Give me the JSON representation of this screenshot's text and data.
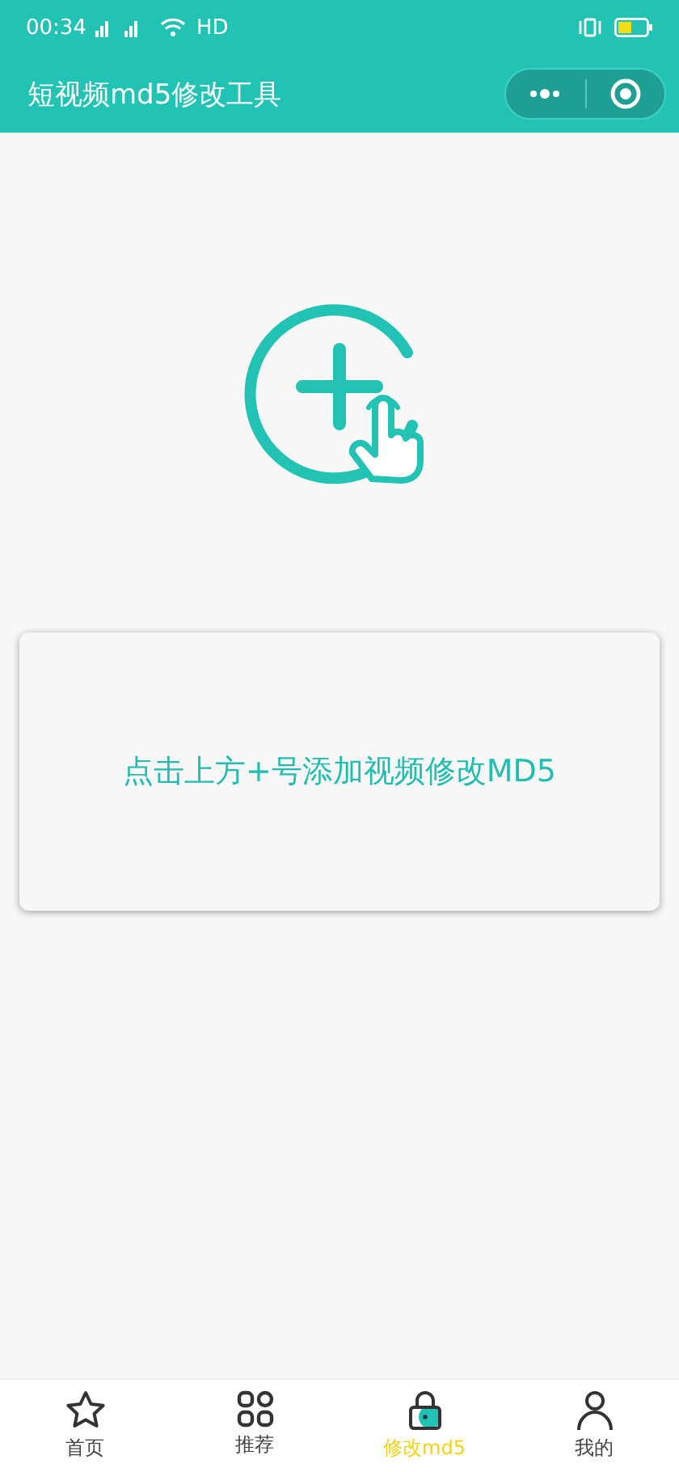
{
  "status_bar": {
    "time": "00:34",
    "network": "HD"
  },
  "nav_bar": {
    "title": "短视频md5修改工具"
  },
  "upload_card": {
    "hint": "点击上方+号添加视频修改MD5"
  },
  "tabs": [
    {
      "kind": "star",
      "label": "首页",
      "selected": false
    },
    {
      "kind": "grid",
      "label": "推荐",
      "selected": false
    },
    {
      "kind": "lock",
      "label": "修改md5",
      "selected": true
    },
    {
      "kind": "person",
      "label": "我的",
      "selected": false
    }
  ]
}
